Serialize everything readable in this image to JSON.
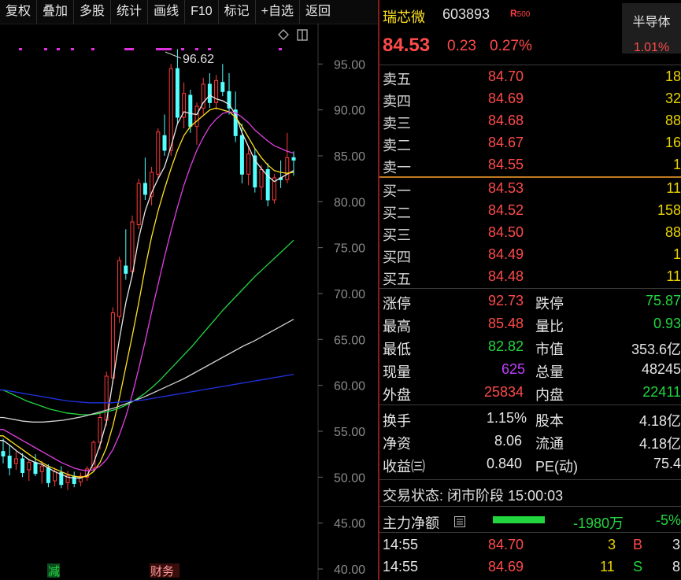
{
  "toolbar": {
    "items": [
      "复权",
      "叠加",
      "多股",
      "统计",
      "画线",
      "F10",
      "标记",
      "+自选",
      "返回"
    ]
  },
  "chart": {
    "high_label": "96.62",
    "y_ticks": [
      "95.00",
      "90.00",
      "85.00",
      "80.00",
      "75.00",
      "70.00",
      "65.00",
      "60.00",
      "55.00",
      "50.00",
      "45.00",
      "40.00"
    ],
    "badge_jian": "减",
    "badge_cai": "财务"
  },
  "chart_data": {
    "type": "candlestick",
    "y_ticks": [
      95,
      90,
      85,
      80,
      75,
      70,
      65,
      60,
      55,
      50,
      45,
      40
    ],
    "ylim": [
      38.8,
      99.4
    ],
    "annotations": [
      {
        "text": "96.62",
        "value": 96.62
      }
    ],
    "candles": [
      [
        52.8,
        54.2,
        51.5,
        52.3
      ],
      [
        52.3,
        53.5,
        50.2,
        51.0
      ],
      [
        51.5,
        52.8,
        50.8,
        52.0
      ],
      [
        52.0,
        52.6,
        50.0,
        50.5
      ],
      [
        50.8,
        52.0,
        49.6,
        51.6
      ],
      [
        51.6,
        52.5,
        50.1,
        50.4
      ],
      [
        50.6,
        51.8,
        49.3,
        51.2
      ],
      [
        51.0,
        51.4,
        48.9,
        49.4
      ],
      [
        49.6,
        51.0,
        49.0,
        50.6
      ],
      [
        50.5,
        51.2,
        48.8,
        49.2
      ],
      [
        49.4,
        50.7,
        48.6,
        50.2
      ],
      [
        50.1,
        50.6,
        48.9,
        49.3
      ],
      [
        49.5,
        50.5,
        49.0,
        50.1
      ],
      [
        50.0,
        51.2,
        49.6,
        50.9
      ],
      [
        51.0,
        54.0,
        50.6,
        53.8
      ],
      [
        53.8,
        57.0,
        53.0,
        56.5
      ],
      [
        56.2,
        61.5,
        55.6,
        61.0
      ],
      [
        60.8,
        68.5,
        60.2,
        67.9
      ],
      [
        67.5,
        74.0,
        66.8,
        73.6
      ],
      [
        73.0,
        77.0,
        71.5,
        72.2
      ],
      [
        72.4,
        78.5,
        71.8,
        77.8
      ],
      [
        77.5,
        82.5,
        77.0,
        82.0
      ],
      [
        82.0,
        84.8,
        80.2,
        80.8
      ],
      [
        80.6,
        83.8,
        79.6,
        83.2
      ],
      [
        83.0,
        88.0,
        82.5,
        87.6
      ],
      [
        87.2,
        89.5,
        85.0,
        85.6
      ],
      [
        85.6,
        95.0,
        85.0,
        94.5
      ],
      [
        94.5,
        96.62,
        88.5,
        89.2
      ],
      [
        89.2,
        93.0,
        88.0,
        91.8
      ],
      [
        91.6,
        92.2,
        87.5,
        88.2
      ],
      [
        88.2,
        90.8,
        86.2,
        90.4
      ],
      [
        90.2,
        93.5,
        89.5,
        92.8
      ],
      [
        92.8,
        94.0,
        90.2,
        90.8
      ],
      [
        90.8,
        93.8,
        90.0,
        93.2
      ],
      [
        93.0,
        95.0,
        91.5,
        92.0
      ],
      [
        92.0,
        94.0,
        89.5,
        90.2
      ],
      [
        90.0,
        92.0,
        86.5,
        87.2
      ],
      [
        87.2,
        88.5,
        82.0,
        83.0
      ],
      [
        83.0,
        86.0,
        81.8,
        85.2
      ],
      [
        85.0,
        85.8,
        81.0,
        81.6
      ],
      [
        81.6,
        84.0,
        80.2,
        83.5
      ],
      [
        83.5,
        84.2,
        79.5,
        80.2
      ],
      [
        80.2,
        83.0,
        79.8,
        82.6
      ],
      [
        82.6,
        84.5,
        81.5,
        82.4
      ],
      [
        82.4,
        87.5,
        82.0,
        84.8
      ],
      [
        84.8,
        85.48,
        82.82,
        84.53
      ]
    ],
    "ma_lines": [
      {
        "color": "#e8e8e8",
        "values": [
          54.0,
          53.5,
          52.9,
          52.4,
          51.9,
          51.6,
          51.4,
          51.0,
          50.6,
          50.3,
          50.0,
          49.9,
          49.9,
          50.2,
          51.5,
          53.5,
          56.0,
          60.5,
          65.0,
          69.0,
          72.0,
          76.0,
          79.0,
          81.0,
          82.5,
          83.8,
          86.0,
          88.5,
          89.8,
          89.6,
          89.5,
          90.8,
          91.6,
          91.2,
          91.0,
          90.6,
          89.5,
          87.5,
          86.0,
          84.5,
          83.6,
          82.8,
          82.2,
          82.6,
          83.0,
          83.4
        ]
      },
      {
        "color": "#ffe21f",
        "values": [
          54.5,
          54.0,
          53.5,
          53.0,
          52.5,
          52.0,
          51.6,
          51.2,
          50.9,
          50.6,
          50.3,
          50.1,
          50.0,
          50.1,
          50.6,
          51.6,
          53.2,
          55.6,
          58.6,
          62.0,
          65.4,
          69.0,
          72.8,
          76.2,
          79.0,
          81.4,
          83.6,
          85.6,
          87.2,
          88.2,
          88.8,
          89.4,
          90.0,
          90.2,
          90.0,
          89.8,
          89.2,
          88.2,
          87.0,
          85.8,
          84.8,
          84.0,
          83.4,
          83.2,
          83.1,
          83.2
        ]
      },
      {
        "color": "#e040e0",
        "values": [
          55.2,
          54.8,
          54.4,
          54.0,
          53.6,
          53.2,
          52.8,
          52.4,
          52.0,
          51.6,
          51.3,
          51.0,
          50.8,
          50.7,
          50.8,
          51.2,
          51.9,
          53.0,
          54.6,
          56.6,
          59.0,
          61.8,
          64.8,
          68.0,
          71.0,
          74.0,
          76.8,
          79.4,
          81.8,
          83.8,
          85.6,
          87.0,
          88.2,
          89.0,
          89.6,
          89.8,
          89.7,
          89.2,
          88.6,
          87.8,
          87.2,
          86.6,
          86.1,
          85.8,
          85.5,
          85.3
        ]
      },
      {
        "color": "#22d640",
        "values": [
          59.5,
          59.1,
          58.7,
          58.3,
          58.0,
          57.7,
          57.4,
          57.2,
          57.0,
          56.9,
          56.8,
          56.8,
          56.9,
          57.1,
          57.3,
          57.6,
          58.0,
          58.5,
          59.1,
          59.8,
          60.6,
          61.5,
          62.4,
          63.3,
          64.2,
          65.2,
          66.2,
          67.2,
          68.2,
          69.1,
          70.0,
          70.9,
          71.8,
          72.6,
          73.4,
          74.2,
          75.0,
          75.8
        ]
      },
      {
        "color": "#d0d0d0",
        "values": [
          56.5,
          56.3,
          56.1,
          56.0,
          56.0,
          56.1,
          56.2,
          56.4,
          56.6,
          56.9,
          57.2,
          57.5,
          57.9,
          58.3,
          58.7,
          59.2,
          59.7,
          60.2,
          60.7,
          61.3,
          61.9,
          62.5,
          63.1,
          63.7,
          64.3,
          64.8,
          65.4,
          66.0,
          66.6,
          67.2
        ]
      },
      {
        "color": "#2030e0",
        "values": [
          59.5,
          59.3,
          59.1,
          58.9,
          58.7,
          58.5,
          58.3,
          58.2,
          58.1,
          58.1,
          58.1,
          58.2,
          58.3,
          58.4,
          58.6,
          58.8,
          59.0,
          59.2,
          59.4,
          59.6,
          59.8,
          60.0,
          60.2,
          60.4,
          60.6,
          60.8,
          61.0,
          61.2
        ]
      }
    ]
  },
  "stock": {
    "name": "瑞芯微",
    "code": "603893",
    "badge": "R",
    "badge_sub": "500",
    "sector": "半导体",
    "sector_change": "1.01%",
    "price": "84.53",
    "change": "0.23",
    "change_pct": "0.27%"
  },
  "asks": [
    {
      "label": "卖五",
      "price": "84.70",
      "vol": "18"
    },
    {
      "label": "卖四",
      "price": "84.69",
      "vol": "32"
    },
    {
      "label": "卖三",
      "price": "84.68",
      "vol": "88"
    },
    {
      "label": "卖二",
      "price": "84.67",
      "vol": "16"
    },
    {
      "label": "卖一",
      "price": "84.55",
      "vol": "1"
    }
  ],
  "bids": [
    {
      "label": "买一",
      "price": "84.53",
      "vol": "11"
    },
    {
      "label": "买二",
      "price": "84.52",
      "vol": "158"
    },
    {
      "label": "买三",
      "price": "84.50",
      "vol": "88"
    },
    {
      "label": "买四",
      "price": "84.49",
      "vol": "1"
    },
    {
      "label": "买五",
      "price": "84.48",
      "vol": "11"
    }
  ],
  "stats": {
    "limit_up_label": "涨停",
    "limit_up": "92.73",
    "limit_down_label": "跌停",
    "limit_down": "75.87",
    "high_label": "最高",
    "high": "85.48",
    "vol_ratio_label": "量比",
    "vol_ratio": "0.93",
    "low_label": "最低",
    "low": "82.82",
    "mkt_cap_label": "市值",
    "mkt_cap": "353.6亿",
    "cur_vol_label": "现量",
    "cur_vol": "625",
    "total_vol_label": "总量",
    "total_vol": "48245",
    "outer_label": "外盘",
    "outer": "25834",
    "inner_label": "内盘",
    "inner": "22411",
    "turnover_label": "换手",
    "turnover": "1.15%",
    "share_cap_label": "股本",
    "share_cap": "4.18亿",
    "nav_label": "净资",
    "nav": "8.06",
    "float_label": "流通",
    "float": "4.18亿",
    "eps_label": "收益㈢",
    "eps": "0.840",
    "pe_label": "PE(动)",
    "pe": "75.4"
  },
  "status": {
    "label": "交易状态:",
    "value": "闭市阶段 15:00:03"
  },
  "flow": {
    "label": "主力净额",
    "value": "-1980万",
    "pct": "-5%",
    "bar_color": "#22d640"
  },
  "ticks": [
    {
      "time": "14:55",
      "price": "84.70",
      "vol": "3",
      "dir": "B",
      "count": "3"
    },
    {
      "time": "14:55",
      "price": "84.69",
      "vol": "11",
      "dir": "S",
      "count": "8"
    }
  ]
}
